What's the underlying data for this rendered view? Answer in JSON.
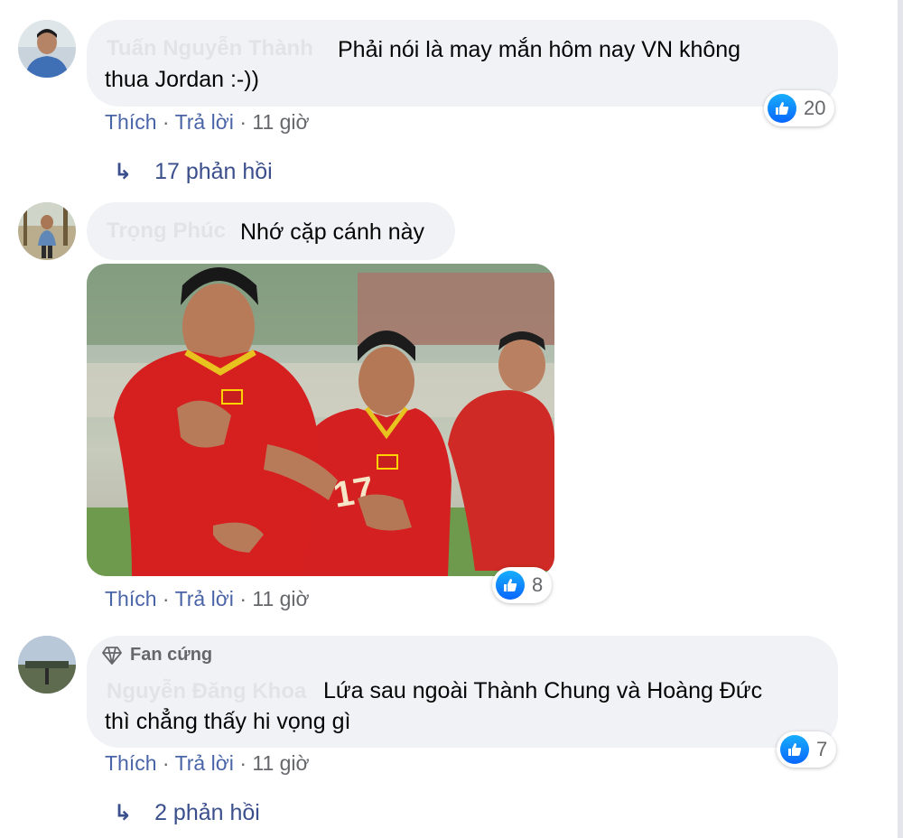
{
  "comments": [
    {
      "author": "Tuấn Nguyễn Thành",
      "text_line1": "Phải nói là may mắn hôm nay VN không",
      "text_line2": "thua Jordan :-))",
      "like_label": "Thích",
      "reply_label": "Trả lời",
      "time": "11 giờ",
      "reaction_count": "20",
      "replies_label": "17 phản hồi"
    },
    {
      "author": "Trọng Phúc",
      "text": "Nhớ cặp cánh này",
      "like_label": "Thích",
      "reply_label": "Trả lời",
      "time": "11 giờ",
      "reaction_count": "8"
    },
    {
      "badge": "Fan cứng",
      "author": "Nguyễn Đăng Khoa",
      "text_line1": "Lứa sau ngoài Thành Chung và Hoàng Đức",
      "text_line2": "thì chẳng thấy hi vọng gì",
      "like_label": "Thích",
      "reply_label": "Trả lời",
      "time": "11 giờ",
      "reaction_count": "7",
      "replies_label": "2 phản hồi"
    }
  ],
  "separator": "·",
  "reply_arrow": "↳",
  "colors": {
    "bubble": "#f0f2f5",
    "link": "#4a64a8",
    "like_blue": "#0866ff",
    "jersey_red": "#d42020"
  },
  "icons": {
    "like": "thumbs-up-icon",
    "badge": "diamond-icon",
    "reply": "reply-arrow-icon"
  }
}
